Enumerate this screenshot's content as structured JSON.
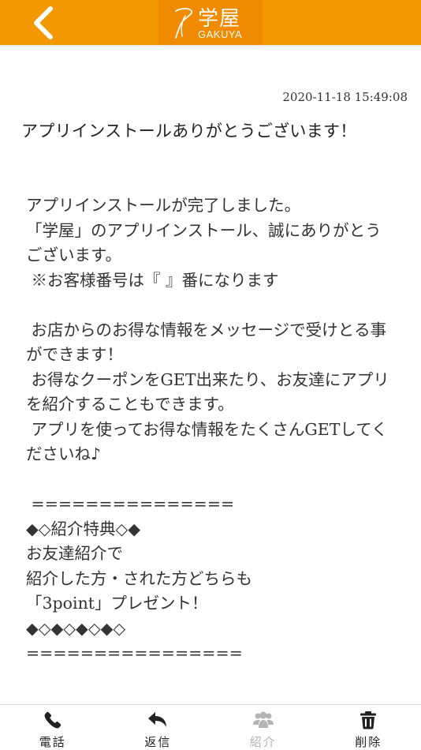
{
  "header": {
    "logo_title": "学屋",
    "logo_sub": "GAKUYA",
    "back_icon": "chevron-left-icon",
    "brand_color": "#f39800"
  },
  "message": {
    "timestamp": "2020-11-18 15:49:08",
    "title": "アプリインストールありがとうございます！",
    "body": "アプリインストールが完了しました。\n「学屋」のアプリインストール、誠にありがとうございます。\n ※お客様番号は『 』番になります\n\n お店からのお得な情報をメッセージで受けとる事ができます！\n お得なクーポンをGET出来たり、お友達にアプリを紹介することもできます。\n アプリを使ってお得な情報をたくさんGETしてくださいね♪\n\n ===============\n◆◇紹介特典◇◆\nお友達紹介で\n紹介した方・された方どちらも\n「3point」プレゼント！\n◆◇◆◇◆◇◆◇\n================"
  },
  "tabbar": {
    "items": [
      {
        "label": "電話",
        "icon": "phone-icon",
        "enabled": true
      },
      {
        "label": "返信",
        "icon": "reply-icon",
        "enabled": true
      },
      {
        "label": "紹介",
        "icon": "users-icon",
        "enabled": false
      },
      {
        "label": "削除",
        "icon": "trash-icon",
        "enabled": true
      }
    ]
  }
}
